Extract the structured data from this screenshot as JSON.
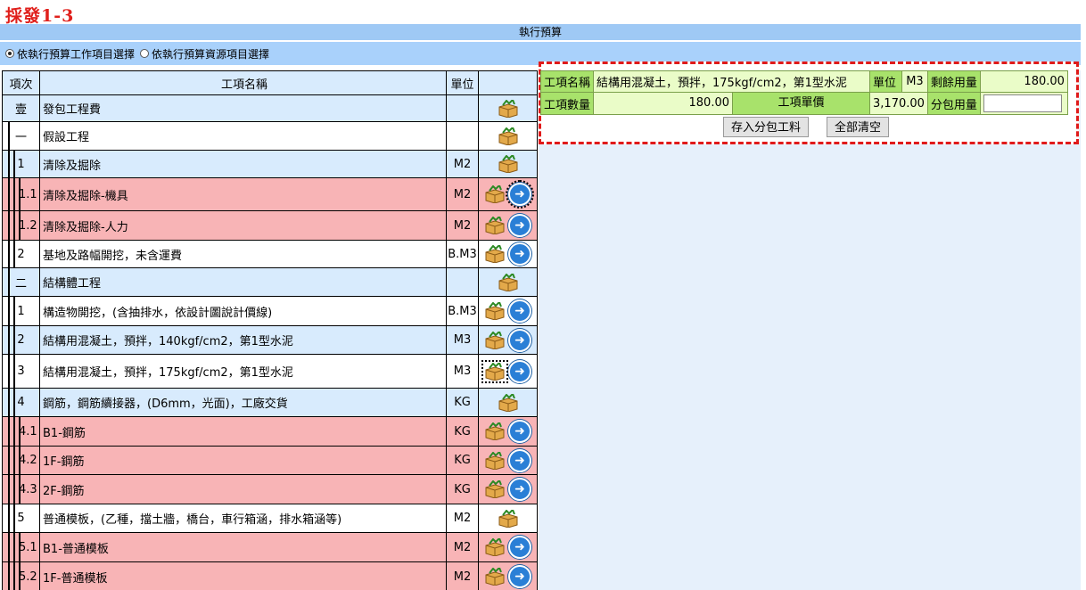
{
  "header_label": "採發1-3",
  "title": "執行預算",
  "radios": [
    {
      "label": "依執行預算工作項目選擇",
      "selected": true
    },
    {
      "label": "依執行預算資源項目選擇",
      "selected": false
    }
  ],
  "columns": {
    "no": "項次",
    "name": "工項名稱",
    "unit": "單位"
  },
  "rows": [
    {
      "no": "壹",
      "name": "發包工程費",
      "unit": "",
      "style": "blue",
      "level": 0,
      "arrow": false
    },
    {
      "no": "一",
      "name": "假設工程",
      "unit": "",
      "style": "white",
      "level": 1,
      "arrow": false
    },
    {
      "no": "1",
      "name": "清除及掘除",
      "unit": "M2",
      "style": "blue",
      "level": 2,
      "arrow": false
    },
    {
      "no": "1.1",
      "name": "清除及掘除-機具",
      "unit": "M2",
      "style": "pink",
      "level": 3,
      "arrow": true,
      "arrow_focus": true
    },
    {
      "no": "1.2",
      "name": "清除及掘除-人力",
      "unit": "M2",
      "style": "pink",
      "level": 3,
      "arrow": true
    },
    {
      "no": "2",
      "name": "基地及路幅開挖，未含運費",
      "unit": "B.M3",
      "style": "white",
      "level": 2,
      "arrow": true
    },
    {
      "no": "二",
      "name": "結構體工程",
      "unit": "",
      "style": "blue",
      "level": 1,
      "arrow": false
    },
    {
      "no": "1",
      "name": "構造物開挖，(含抽排水，依設計圖說計價線)",
      "unit": "B.M3",
      "style": "white",
      "level": 2,
      "arrow": true
    },
    {
      "no": "2",
      "name": "結構用混凝土，預拌，140kgf/cm2，第1型水泥",
      "unit": "M3",
      "style": "blue",
      "level": 2,
      "arrow": true
    },
    {
      "no": "3",
      "name": "結構用混凝土，預拌，175kgf/cm2，第1型水泥",
      "unit": "M3",
      "style": "white",
      "level": 2,
      "arrow": true,
      "box_focus": true
    },
    {
      "no": "4",
      "name": "鋼筋，鋼筋續接器，(D6mm，光面)，工廠交貨",
      "unit": "KG",
      "style": "blue",
      "level": 2,
      "arrow": false
    },
    {
      "no": "4.1",
      "name": "B1-鋼筋",
      "unit": "KG",
      "style": "pink",
      "level": 3,
      "arrow": true
    },
    {
      "no": "4.2",
      "name": "1F-鋼筋",
      "unit": "KG",
      "style": "pink",
      "level": 3,
      "arrow": true
    },
    {
      "no": "4.3",
      "name": "2F-鋼筋",
      "unit": "KG",
      "style": "pink",
      "level": 3,
      "arrow": true
    },
    {
      "no": "5",
      "name": "普通模板，(乙種，擋土牆，橋台，車行箱涵，排水箱涵等)",
      "unit": "M2",
      "style": "white",
      "level": 2,
      "arrow": false
    },
    {
      "no": "5.1",
      "name": "B1-普通模板",
      "unit": "M2",
      "style": "pink",
      "level": 3,
      "arrow": true
    },
    {
      "no": "5.2",
      "name": "1F-普通模板",
      "unit": "M2",
      "style": "pink",
      "level": 3,
      "arrow": true
    }
  ],
  "form": {
    "name_label": "工項名稱",
    "name_value": "結構用混凝土，預拌，175kgf/cm2，第1型水泥",
    "unit_label": "單位",
    "unit_value": "M3",
    "remain_label": "剩餘用量",
    "remain_value": "180.00",
    "qty_label": "工項數量",
    "qty_value": "180.00",
    "price_label": "工項單價",
    "price_value": "3,170.00",
    "sub_label": "分包用量",
    "sub_value": ""
  },
  "buttons": {
    "save": "存入分包工料",
    "clear": "全部清空"
  },
  "colors": {
    "title_bar": "#9fc9f5",
    "row_blue": "#d8ebfd",
    "row_pink": "#f8b4b6",
    "form_label": "#a8e26b",
    "form_value": "#eafcc8",
    "highlight_dash": "#e01a1a"
  }
}
